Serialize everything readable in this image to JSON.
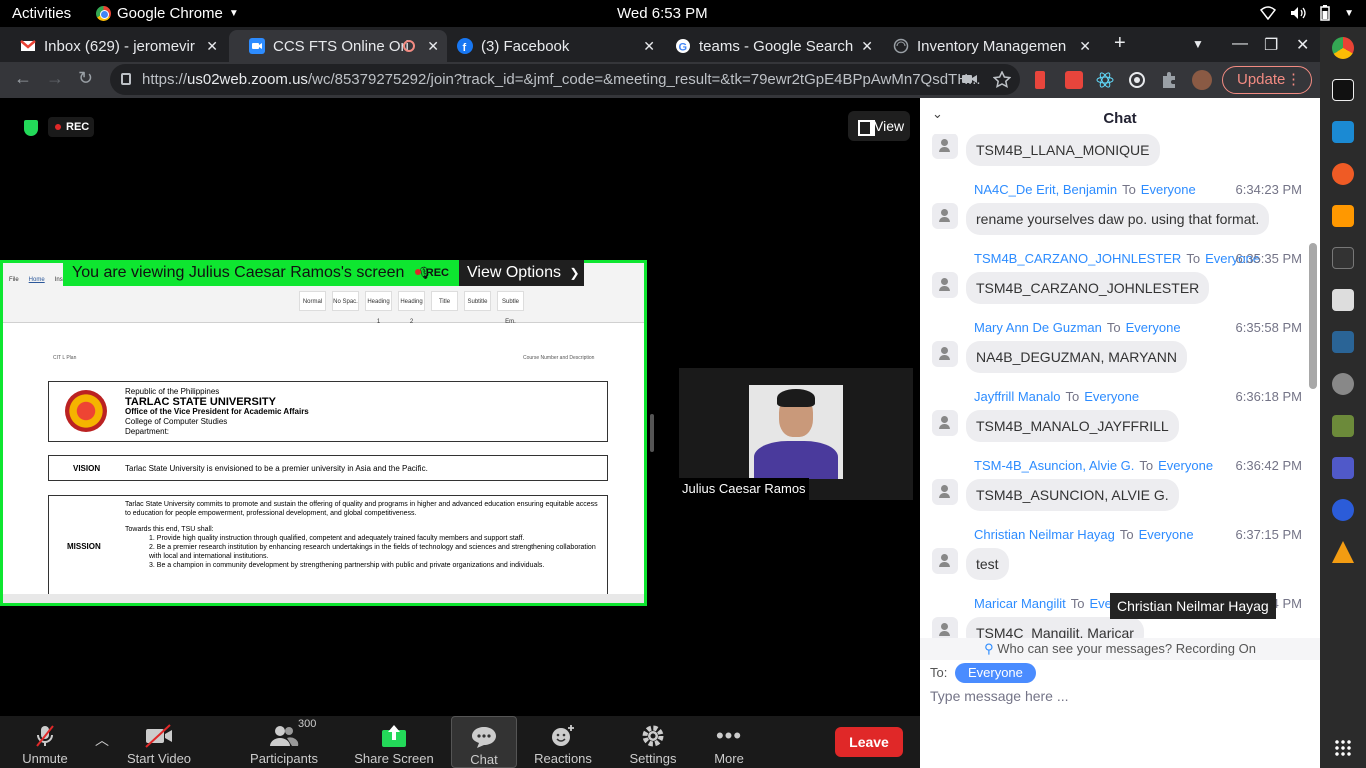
{
  "gnome": {
    "activities": "Activities",
    "app_name": "Google Chrome",
    "clock": "Wed  6:53 PM"
  },
  "tabs": [
    {
      "title": "Inbox (629) - jeromevir",
      "icon": "gmail-icon"
    },
    {
      "title": "CCS FTS Online Ori",
      "icon": "zoom-icon"
    },
    {
      "title": "(3) Facebook",
      "icon": "facebook-icon"
    },
    {
      "title": "teams - Google Search",
      "icon": "google-icon"
    },
    {
      "title": "Inventory Managemen",
      "icon": "globe-icon"
    }
  ],
  "browser": {
    "url_host": "us02web.zoom.us",
    "url_rest": "/wc/85379275292/join?track_id=&jmf_code=&meeting_result=&tk=79ewr2tGpE4BPpAwMn7QsdTH...",
    "url_prefix": "https://",
    "update_label": "Update"
  },
  "meeting": {
    "rec_label": "REC",
    "view_label": "View",
    "share_banner": "You are viewing Julius Caesar Ramos's screen",
    "view_options": "View Options",
    "participant_name": "Julius Caesar Ramos"
  },
  "document": {
    "ribbon_menu": [
      "File",
      "Home",
      "Insert",
      "Draw",
      "Design",
      "Layout",
      "References",
      "Mailings",
      "Review",
      "View"
    ],
    "styles": [
      "Normal",
      "No Spac.",
      "Heading 1",
      "Heading 2",
      "Title",
      "Subtitle",
      "Subtle Em."
    ],
    "header_left": "CIT  L Plan",
    "header_right": "Course Number and Description",
    "univ_line1": "Republic of the Philippines",
    "univ_name": "TARLAC STATE UNIVERSITY",
    "univ_office": "Office of the Vice President for Academic Affairs",
    "univ_college": "College of  Computer Studies",
    "univ_dept": "Department:",
    "vision_label": "VISION",
    "vision_text": "Tarlac State University is envisioned to be a premier university in Asia and the Pacific.",
    "mission_label": "MISSION",
    "mission_text": "Tarlac State University commits to promote and sustain the offering of quality and programs in higher and advanced education ensuring equitable access to education for people empowerment, professional development, and global competitiveness.",
    "mission_goal": "Towards this end, TSU shall:",
    "mission_items": [
      "1.   Provide high quality instruction through qualified, competent and adequately trained faculty members and support staff.",
      "2.   Be a premier research institution by enhancing research undertakings in the fields of technology and sciences and strengthening collaboration with local and international institutions.",
      "3.   Be a champion in community development by strengthening partnership with public and private organizations and individuals."
    ]
  },
  "controls": {
    "unmute": "Unmute",
    "start_video": "Start Video",
    "participants": "Participants",
    "participants_count": "300",
    "share_screen": "Share Screen",
    "chat": "Chat",
    "reactions": "Reactions",
    "settings": "Settings",
    "more": "More",
    "leave": "Leave"
  },
  "chat": {
    "title": "Chat",
    "first_bubble": "TSM4B_LLANA_MONIQUE",
    "messages": [
      {
        "sender": "NA4C_De Erit, Benjamin",
        "to": "To",
        "recipient": "Everyone",
        "time": "6:34:23 PM",
        "text": "rename yourselves daw po. using that format."
      },
      {
        "sender": "TSM4B_CARZANO_JOHNLESTER",
        "to": "To",
        "recipient": "Everyone",
        "time": "6:35:35 PM",
        "text": "TSM4B_CARZANO_JOHNLESTER"
      },
      {
        "sender": "Mary Ann De Guzman",
        "to": "To",
        "recipient": "Everyone",
        "time": "6:35:58 PM",
        "text": "NA4B_DEGUZMAN, MARYANN"
      },
      {
        "sender": "Jayffrill Manalo",
        "to": "To",
        "recipient": "Everyone",
        "time": "6:36:18 PM",
        "text": "TSM4B_MANALO_JAYFFRILL"
      },
      {
        "sender": "TSM-4B_Asuncion, Alvie G.",
        "to": "To",
        "recipient": "Everyone",
        "time": "6:36:42 PM",
        "text": "TSM4B_ASUNCION, ALVIE G."
      },
      {
        "sender": "Christian Neilmar Hayag",
        "to": "To",
        "recipient": "Everyone",
        "time": "6:37:15 PM",
        "text": "test"
      },
      {
        "sender": "Maricar Mangilit",
        "to": "To",
        "recipient": "Everyone",
        "time": "6:39:24 PM",
        "text": "TSM4C_Mangilit, Maricar"
      }
    ],
    "tooltip": "Christian Neilmar Hayag",
    "privacy_note": "Who can see your messages? Recording On",
    "to_label": "To:",
    "to_value": "Everyone",
    "input_placeholder": "Type message here ..."
  },
  "colors": {
    "zoom_blue": "#2d8cff",
    "share_green": "#0ee630",
    "leave_red": "#e02828"
  }
}
